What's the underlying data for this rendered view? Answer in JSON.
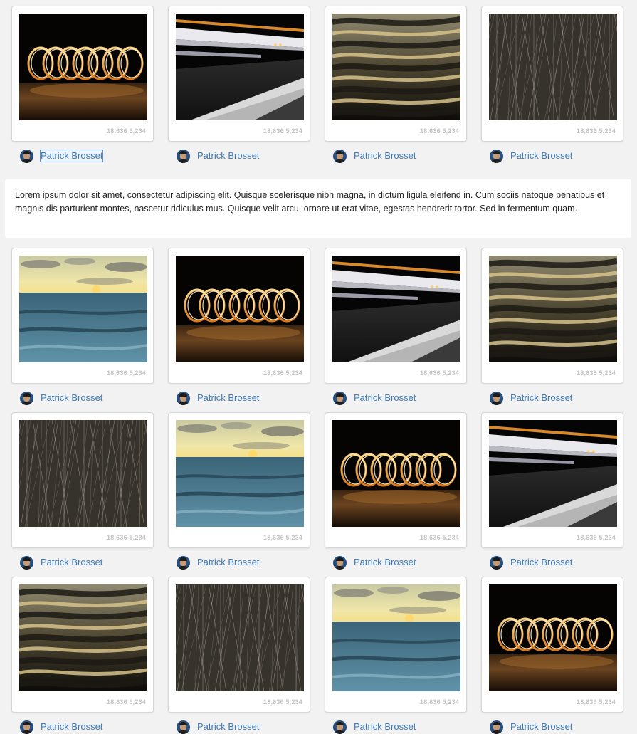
{
  "stats_text": "18,636 5,234",
  "author_name": "Patrick Brosset",
  "note_text": "Lorem ipsum dolor sit amet, consectetur adipiscing elit. Quisque scelerisque nibh magna, in dictum ligula eleifend in. Cum sociis natoque penatibus et magnis dis parturient montes, nascetur ridiculus mus. Quisque velit arcu, ornare ut erat vitae, egestas hendrerit tortor. Sed in fermentum quam.",
  "rows": [
    [
      {
        "photo": "fire-spiral"
      },
      {
        "photo": "light-trails"
      },
      {
        "photo": "golden-water"
      },
      {
        "photo": "light-scratches"
      }
    ],
    [
      {
        "photo": "sea-sunset"
      },
      {
        "photo": "fire-spiral"
      },
      {
        "photo": "light-trails"
      },
      {
        "photo": "golden-water"
      }
    ],
    [
      {
        "photo": "light-scratches"
      },
      {
        "photo": "sea-sunset"
      },
      {
        "photo": "fire-spiral"
      },
      {
        "photo": "light-trails"
      }
    ],
    [
      {
        "photo": "golden-water"
      },
      {
        "photo": "light-scratches"
      },
      {
        "photo": "sea-sunset"
      },
      {
        "photo": "fire-spiral"
      }
    ]
  ]
}
